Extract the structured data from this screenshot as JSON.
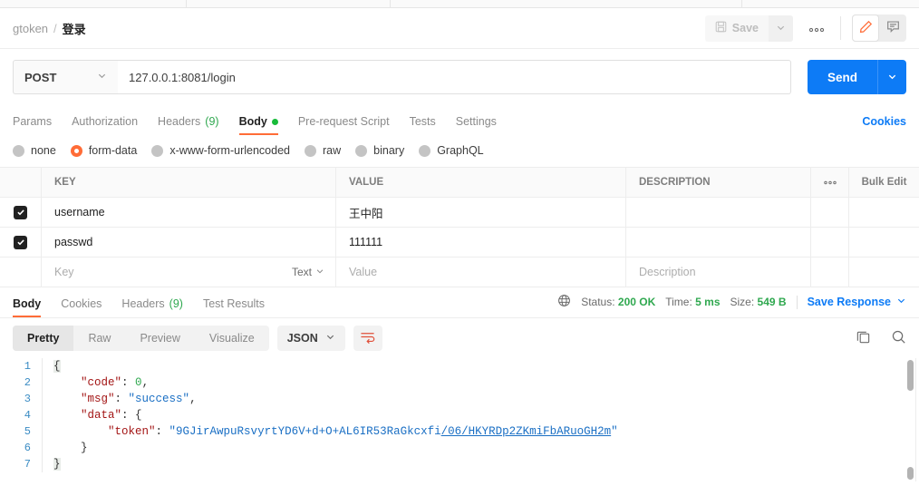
{
  "breadcrumb": {
    "collection": "gtoken",
    "separator": "/",
    "request": "登录"
  },
  "toolbar": {
    "save_label": "Save",
    "save_caret_icon": "chevron-down-icon",
    "save_icon": "floppy-disk-icon",
    "more_label": "ooo",
    "edit_icon": "pencil-icon",
    "comment_icon": "comment-icon"
  },
  "request": {
    "method": "POST",
    "method_caret_icon": "chevron-down-icon",
    "url": "127.0.0.1:8081/login",
    "send_label": "Send",
    "send_caret_icon": "chevron-down-icon"
  },
  "request_tabs": [
    {
      "label": "Params",
      "active": false
    },
    {
      "label": "Authorization",
      "active": false
    },
    {
      "label": "Headers",
      "count": "(9)",
      "active": false
    },
    {
      "label": "Body",
      "active": true,
      "dot": true
    },
    {
      "label": "Pre-request Script",
      "active": false
    },
    {
      "label": "Tests",
      "active": false
    },
    {
      "label": "Settings",
      "active": false
    }
  ],
  "cookies_link": "Cookies",
  "body_types": [
    {
      "label": "none",
      "selected": false
    },
    {
      "label": "form-data",
      "selected": true
    },
    {
      "label": "x-www-form-urlencoded",
      "selected": false
    },
    {
      "label": "raw",
      "selected": false
    },
    {
      "label": "binary",
      "selected": false
    },
    {
      "label": "GraphQL",
      "selected": false
    }
  ],
  "params_table": {
    "headers": {
      "key": "KEY",
      "value": "VALUE",
      "description": "DESCRIPTION",
      "more": "ooo",
      "bulk_edit": "Bulk Edit"
    },
    "rows": [
      {
        "checked": true,
        "key": "username",
        "value": "王中阳",
        "description": ""
      },
      {
        "checked": true,
        "key": "passwd",
        "value": "111111",
        "description": ""
      }
    ],
    "new_row": {
      "key_placeholder": "Key",
      "type_label": "Text",
      "type_caret_icon": "chevron-down-icon",
      "value_placeholder": "Value",
      "description_placeholder": "Description"
    }
  },
  "response_tabs": [
    {
      "label": "Body",
      "active": true
    },
    {
      "label": "Cookies",
      "active": false
    },
    {
      "label": "Headers",
      "count": "(9)",
      "active": false
    },
    {
      "label": "Test Results",
      "active": false
    }
  ],
  "response_status": {
    "globe_icon": "globe-icon",
    "status_label": "Status:",
    "status_value": "200 OK",
    "time_label": "Time:",
    "time_value": "5 ms",
    "size_label": "Size:",
    "size_value": "549 B",
    "save_response_label": "Save Response",
    "save_response_caret_icon": "chevron-down-icon"
  },
  "format_bar": {
    "segments": [
      {
        "label": "Pretty",
        "active": true
      },
      {
        "label": "Raw",
        "active": false
      },
      {
        "label": "Preview",
        "active": false
      },
      {
        "label": "Visualize",
        "active": false
      }
    ],
    "language": "JSON",
    "language_caret_icon": "chevron-down-icon",
    "wrap_icon": "wrap-lines-icon",
    "copy_icon": "copy-icon",
    "search_icon": "search-icon"
  },
  "response_body": {
    "lines": [
      {
        "num": "1",
        "text": "{"
      },
      {
        "num": "2",
        "text": "    \"code\": 0,"
      },
      {
        "num": "3",
        "text": "    \"msg\": \"success\","
      },
      {
        "num": "4",
        "text": "    \"data\": {"
      },
      {
        "num": "5",
        "text": "        \"token\": \"9GJirAwpuRsvyrtYD6V+d+O+AL6IR53RaGkcxfi/06/HKYRDp2ZKmiFbARuoGH2m\""
      },
      {
        "num": "6",
        "text": "    }"
      },
      {
        "num": "7",
        "text": "}"
      }
    ],
    "token_prefix": "\"9GJirAwpuRsvyrtYD6V+d+O+AL6IR53RaGkcxfi",
    "token_link": "/06/HKYRDp2ZKmiFbARuoGH2m",
    "token_suffix": "\"",
    "key_code": "\"code\"",
    "val_code": "0",
    "key_msg": "\"msg\"",
    "val_msg": "\"success\"",
    "key_data": "\"data\"",
    "key_token": "\"token\""
  },
  "colors": {
    "accent": "#ff6c37",
    "blue": "#0d7bf6",
    "green": "#2fa84f",
    "string": "#1a6fc4",
    "key": "#a31515"
  }
}
